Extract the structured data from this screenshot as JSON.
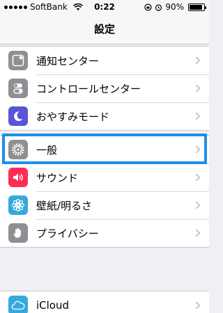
{
  "status_bar": {
    "carrier": "SoftBank",
    "time": "0:22",
    "battery": "90%",
    "battery_level": 0.9
  },
  "nav": {
    "title": "設定"
  },
  "group1": [
    {
      "label": "通知センター",
      "icon": "notification-center-icon",
      "color": "#8e8e93"
    },
    {
      "label": "コントロールセンター",
      "icon": "control-center-icon",
      "color": "#8e8e93"
    },
    {
      "label": "おやすみモード",
      "icon": "moon-icon",
      "color": "#5856d6"
    }
  ],
  "group2": [
    {
      "label": "一般",
      "icon": "gear-icon",
      "color": "#8e8e93"
    },
    {
      "label": "サウンド",
      "icon": "speaker-icon",
      "color": "#ff2d55"
    },
    {
      "label": "壁紙/明るさ",
      "icon": "flower-icon",
      "color": "#34aadc"
    },
    {
      "label": "プライバシー",
      "icon": "hand-icon",
      "color": "#8e8e93"
    }
  ],
  "group3": [
    {
      "label": "iCloud",
      "icon": "cloud-icon",
      "color": "#34aadc"
    }
  ],
  "highlight_color": "#1e8fe8"
}
